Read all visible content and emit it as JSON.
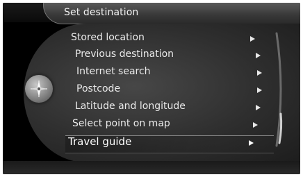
{
  "header": {
    "title": "Set destination"
  },
  "menu": {
    "items": [
      {
        "label": "Stored location"
      },
      {
        "label": "Previous destination"
      },
      {
        "label": "Internet search"
      },
      {
        "label": "Postcode"
      },
      {
        "label": "Latitude and longitude"
      },
      {
        "label": "Select point on map"
      },
      {
        "label": "Travel guide",
        "selected": true
      }
    ]
  },
  "knob": {
    "icon": "navigation-compass-icon"
  }
}
